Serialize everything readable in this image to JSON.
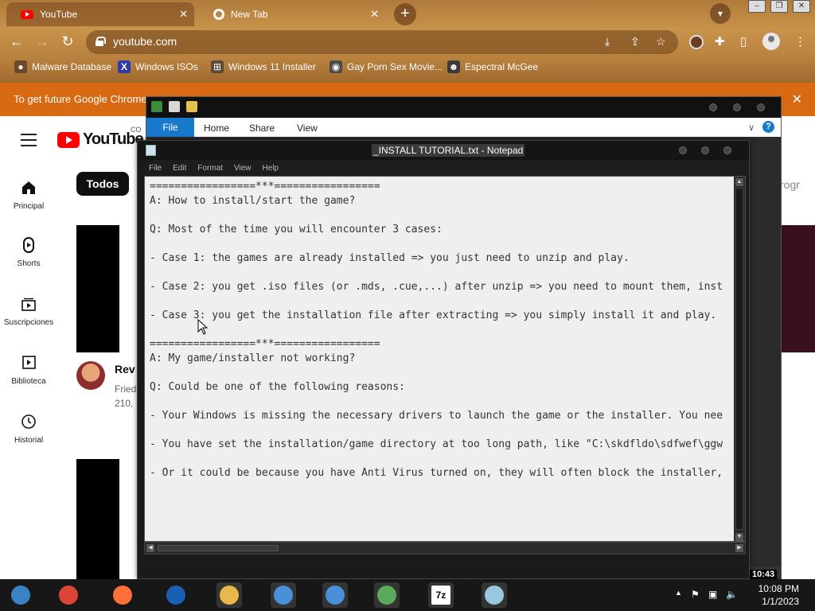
{
  "browser": {
    "tabs": [
      {
        "title": "YouTube",
        "active": true
      },
      {
        "title": "New Tab",
        "active": false
      }
    ],
    "url": "youtube.com",
    "bookmarks": [
      {
        "label": "Malware Database"
      },
      {
        "label": "Windows ISOs"
      },
      {
        "label": "Windows 11 Installer"
      },
      {
        "label": "Gay Porn Sex Movie..."
      },
      {
        "label": "Espectral McGee"
      }
    ],
    "infobar_text": "To get future Google Chrome",
    "accent": "#d86a14"
  },
  "youtube": {
    "logo_text": "YouTube",
    "logo_sup": "CO",
    "sidebar": [
      {
        "label": "Principal",
        "icon": "home-icon"
      },
      {
        "label": "Shorts",
        "icon": "shorts-icon"
      },
      {
        "label": "Suscripciones",
        "icon": "subscriptions-icon"
      },
      {
        "label": "Biblioteca",
        "icon": "library-icon"
      },
      {
        "label": "Historial",
        "icon": "history-icon"
      }
    ],
    "chip_active": "Todos",
    "right_chip_partial": "rogr",
    "video": {
      "title_partial": "Rev",
      "meta_line1": "Fried",
      "meta_line2": "210,",
      "duration": "10:43"
    }
  },
  "explorer": {
    "ribbon_tabs": [
      "File",
      "Home",
      "Share",
      "View"
    ],
    "help": "?"
  },
  "notepad": {
    "title": "_INSTALL TUTORIAL.txt - Notepad",
    "menu": [
      "File",
      "Edit",
      "Format",
      "View",
      "Help"
    ],
    "lines": [
      "=================***=================",
      "A: How to install/start the game?",
      "",
      "Q: Most of the time you will encounter 3 cases:",
      "",
      "- Case 1: the games are already installed => you just need to unzip and play.",
      "",
      "- Case 2: you get .iso files (or .mds, .cue,...) after unzip => you need to mount them, inst",
      "",
      "- Case 3: you get the installation file after extracting => you simply install it and play.",
      "",
      "=================***=================",
      "A: My game/installer not working?",
      "",
      "Q: Could be one of the following reasons:",
      "",
      "- Your Windows is missing the necessary drivers to launch the game or the installer. You nee",
      "",
      "- You have set the installation/game directory at too long path, like \"C:\\skdfldo\\sdfwef\\ggw",
      "",
      "- Or it could be because you have Anti Virus turned on, they will often block the installer,"
    ]
  },
  "taskbar": {
    "apps": [
      {
        "name": "chromium-app-icon",
        "color": "#3b82c4"
      },
      {
        "name": "chrome-app-icon",
        "color": "#db4437"
      },
      {
        "name": "firefox-app-icon",
        "color": "#ff7139"
      },
      {
        "name": "obama-logo-app-icon",
        "color": "#1a5fb4"
      },
      {
        "name": "file-explorer-app-icon",
        "color": "#e8b84a"
      },
      {
        "name": "installer-app-icon",
        "color": "#4a90d9"
      },
      {
        "name": "installer-2-app-icon",
        "color": "#4a90d9"
      },
      {
        "name": "network-app-icon",
        "color": "#5aaa5a"
      },
      {
        "name": "7zip-app-icon",
        "color": "#ffffff",
        "label": "7z"
      },
      {
        "name": "notepad-app-icon",
        "color": "#9ac7e0"
      }
    ],
    "time": "10:08 PM",
    "date": "1/1/2023"
  }
}
